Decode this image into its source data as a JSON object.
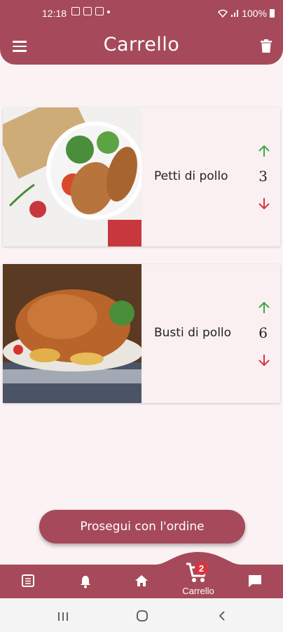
{
  "status_bar": {
    "time": "12:18",
    "battery": "100%"
  },
  "app_bar": {
    "title": "Carrello"
  },
  "cart": {
    "items": [
      {
        "name": "Petti di pollo",
        "quantity": "3"
      },
      {
        "name": "Busti di pollo",
        "quantity": "6"
      }
    ]
  },
  "proceed_button": {
    "label": "Prosegui con l'ordine"
  },
  "bottom_nav": {
    "cart_label": "Carrello",
    "cart_badge": "2"
  },
  "colors": {
    "primary": "#a64a5b",
    "background": "#fbf2f3",
    "arrow_up": "#3aa84a",
    "arrow_down": "#d83340",
    "badge": "#d83340"
  },
  "icons": [
    "menu-icon",
    "trash-icon",
    "arrow-up-icon",
    "arrow-down-icon",
    "list-icon",
    "bell-icon",
    "home-icon",
    "cart-icon",
    "chat-icon"
  ]
}
